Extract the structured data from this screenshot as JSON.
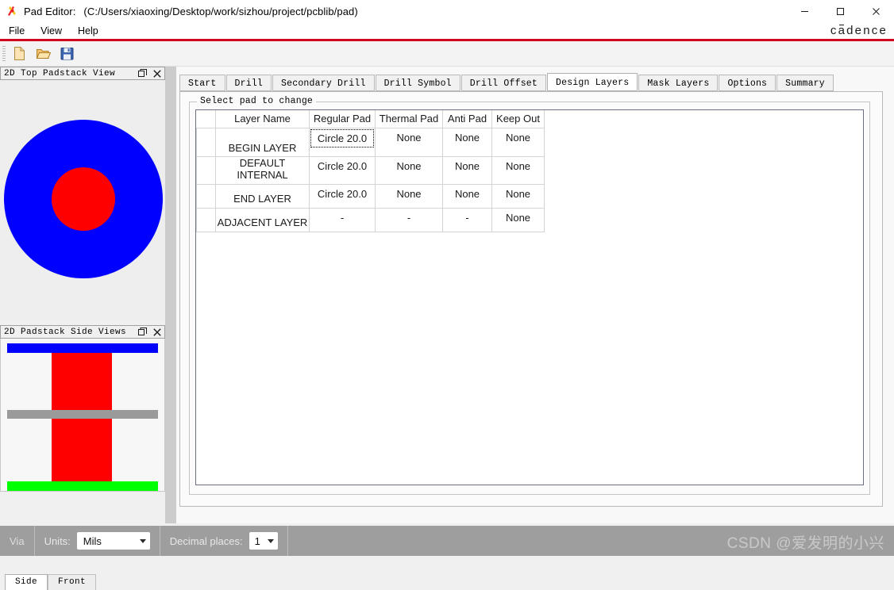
{
  "window": {
    "app_name": "Pad Editor:",
    "file_path": "(C:/Users/xiaoxing/Desktop/work/sizhou/project/pcblib/pad)",
    "minimize": "—",
    "maximize": "□",
    "close": "✕",
    "brand": "cadence"
  },
  "menubar": {
    "items": [
      "File",
      "View",
      "Help"
    ]
  },
  "toolbar": {
    "buttons": [
      {
        "name": "new-file",
        "label": "New"
      },
      {
        "name": "open-file",
        "label": "Open"
      },
      {
        "name": "save-file",
        "label": "Save"
      }
    ]
  },
  "left_dock": {
    "top_panel": {
      "title": "2D Top Padstack View",
      "float_btn": "❐",
      "close_btn": "✕",
      "pad_outer_color": "#0000ff",
      "pad_inner_color": "#ff0000"
    },
    "side_panel": {
      "title": "2D Padstack Side Views",
      "float_btn": "❐",
      "close_btn": "✕",
      "top_layer_color": "#0000ff",
      "bottom_layer_color": "#00ff00",
      "internal_layer_color": "#9a9a9a",
      "barrel_color": "#ff0000"
    },
    "view_tabs": [
      {
        "label": "Side",
        "active": true
      },
      {
        "label": "Front",
        "active": false
      }
    ]
  },
  "main": {
    "tabs": [
      {
        "label": "Start",
        "active": false
      },
      {
        "label": "Drill",
        "active": false
      },
      {
        "label": "Secondary Drill",
        "active": false
      },
      {
        "label": "Drill Symbol",
        "active": false
      },
      {
        "label": "Drill Offset",
        "active": false
      },
      {
        "label": "Design Layers",
        "active": true
      },
      {
        "label": "Mask Layers",
        "active": false
      },
      {
        "label": "Options",
        "active": false
      },
      {
        "label": "Summary",
        "active": false
      }
    ],
    "group_title": "Select pad to change",
    "table": {
      "columns": [
        "",
        "Layer Name",
        "Regular Pad",
        "Thermal Pad",
        "Anti Pad",
        "Keep Out"
      ],
      "rows": [
        {
          "layer_name": "BEGIN LAYER",
          "layer_enabled": true,
          "regular_pad": "Circle 20.0",
          "thermal_pad": "None",
          "anti_pad": "None",
          "keep_out": "None",
          "focused_cell": "regular_pad"
        },
        {
          "layer_name": "DEFAULT INTERNAL",
          "layer_enabled": false,
          "regular_pad": "Circle 20.0",
          "thermal_pad": "None",
          "anti_pad": "None",
          "keep_out": "None",
          "focused_cell": ""
        },
        {
          "layer_name": "END LAYER",
          "layer_enabled": true,
          "regular_pad": "Circle 20.0",
          "thermal_pad": "None",
          "anti_pad": "None",
          "keep_out": "None",
          "focused_cell": ""
        },
        {
          "layer_name": "ADJACENT LAYER",
          "layer_enabled": false,
          "regular_pad": "-",
          "thermal_pad": "-",
          "anti_pad": "-",
          "keep_out": "None",
          "focused_cell": ""
        }
      ]
    }
  },
  "statusbar": {
    "mode_label": "Via",
    "units_label": "Units:",
    "units_value": "Mils",
    "decimal_label": "Decimal places:",
    "decimal_value": "1"
  },
  "watermark": "CSDN @爱发明的小兴"
}
